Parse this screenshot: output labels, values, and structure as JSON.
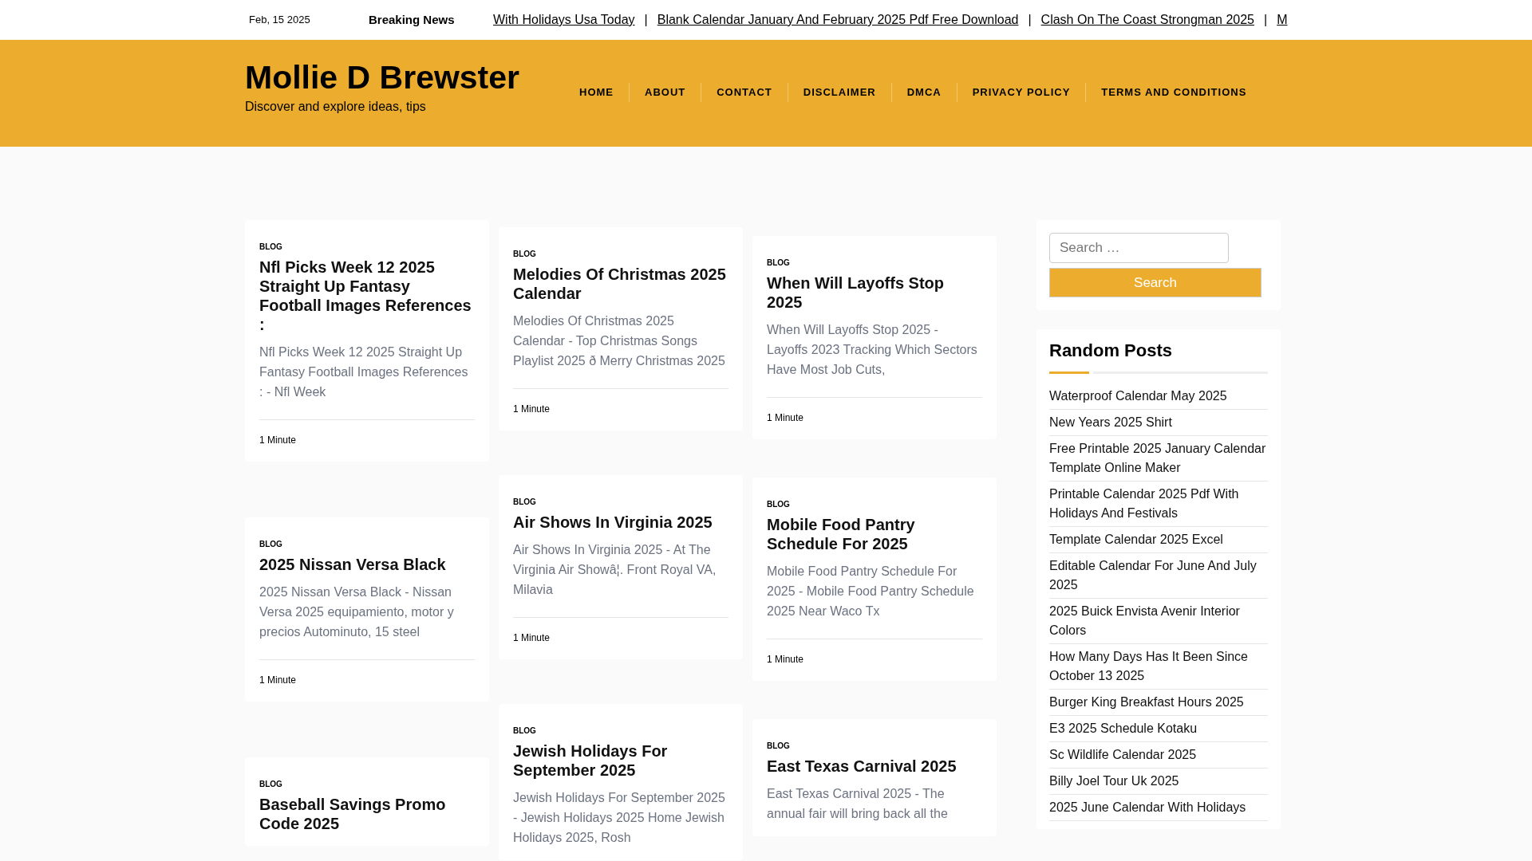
{
  "top_bar": {
    "date": "Feb, 15 2025",
    "breaking_label": "Breaking News",
    "ticker": [
      {
        "text": "With Holidays Usa Today",
        "separator": "|"
      },
      {
        "text": "Blank Calendar January And February 2025 Pdf Free Download",
        "separator": "|"
      },
      {
        "text": "Clash On The Coast Strongman 2025",
        "separator": "|"
      },
      {
        "text": "M"
      }
    ]
  },
  "header": {
    "site_title": "Mollie D Brewster",
    "tagline": "Discover and explore ideas, tips",
    "nav": [
      "HOME",
      "ABOUT",
      "CONTACT",
      "DISCLAIMER",
      "DMCA",
      "PRIVACY POLICY",
      "TERMS AND CONDITIONS"
    ]
  },
  "columns": [
    [
      {
        "category": "BLOG",
        "title": "Nfl Picks Week 12 2025 Straight Up Fantasy Football Images References :",
        "excerpt": "Nfl Picks Week 12 2025 Straight Up Fantasy Football Images References : - Nfl Week",
        "read_time": "1 Minute"
      },
      {
        "category": "BLOG",
        "title": "2025 Nissan Versa Black",
        "excerpt": "2025 Nissan Versa Black - Nissan Versa 2025 equipamiento, motor y precios Autominuto, 15 steel",
        "read_time": "1 Minute"
      },
      {
        "category": "BLOG",
        "title": "Baseball Savings Promo Code 2025"
      }
    ],
    [
      {
        "category": "BLOG",
        "title": "Melodies Of Christmas 2025 Calendar",
        "excerpt": "Melodies Of Christmas 2025 Calendar - Top Christmas Songs Playlist 2025 ð Merry Christmas 2025",
        "read_time": "1 Minute"
      },
      {
        "category": "BLOG",
        "title": "Air Shows In Virginia 2025",
        "excerpt": "Air Shows In Virginia 2025 - At The Virginia Air Showâ¦. Front Royal VA, Milavia",
        "read_time": "1 Minute"
      },
      {
        "category": "BLOG",
        "title": "Jewish Holidays For September 2025",
        "excerpt": "Jewish Holidays For September 2025 - Jewish Holidays 2025 Home Jewish Holidays 2025, Rosh"
      }
    ],
    [
      {
        "category": "BLOG",
        "title": "When Will Layoffs Stop 2025",
        "excerpt": "When Will Layoffs Stop 2025 - Layoffs 2023 Tracking Which Sectors Have Most Job Cuts,",
        "read_time": "1 Minute"
      },
      {
        "category": "BLOG",
        "title": "Mobile Food Pantry Schedule For 2025",
        "excerpt": "Mobile Food Pantry Schedule For 2025 - Mobile Food Pantry Schedule 2025 Near Waco Tx",
        "read_time": "1 Minute"
      },
      {
        "category": "BLOG",
        "title": "East Texas Carnival 2025",
        "excerpt": "East Texas Carnival 2025 - The annual fair will bring back all the"
      }
    ]
  ],
  "sidebar": {
    "search": {
      "placeholder": "Search …",
      "button": "Search"
    },
    "random_posts": {
      "title": "Random Posts",
      "items": [
        "Waterproof Calendar May 2025",
        "New Years 2025 Shirt",
        "Free Printable 2025 January Calendar Template Online Maker",
        "Printable Calendar 2025 Pdf With Holidays And Festivals",
        "Template Calendar 2025 Excel",
        "Editable Calendar For June And July 2025",
        "2025 Buick Envista Avenir Interior Colors",
        "How Many Days Has It Been Since October 13 2025",
        "Burger King Breakfast Hours 2025",
        "E3 2025 Schedule Kotaku",
        "Sc Wildlife Calendar 2025",
        "Billy Joel Tour Uk 2025",
        "2025 June Calendar With Holidays"
      ]
    }
  }
}
